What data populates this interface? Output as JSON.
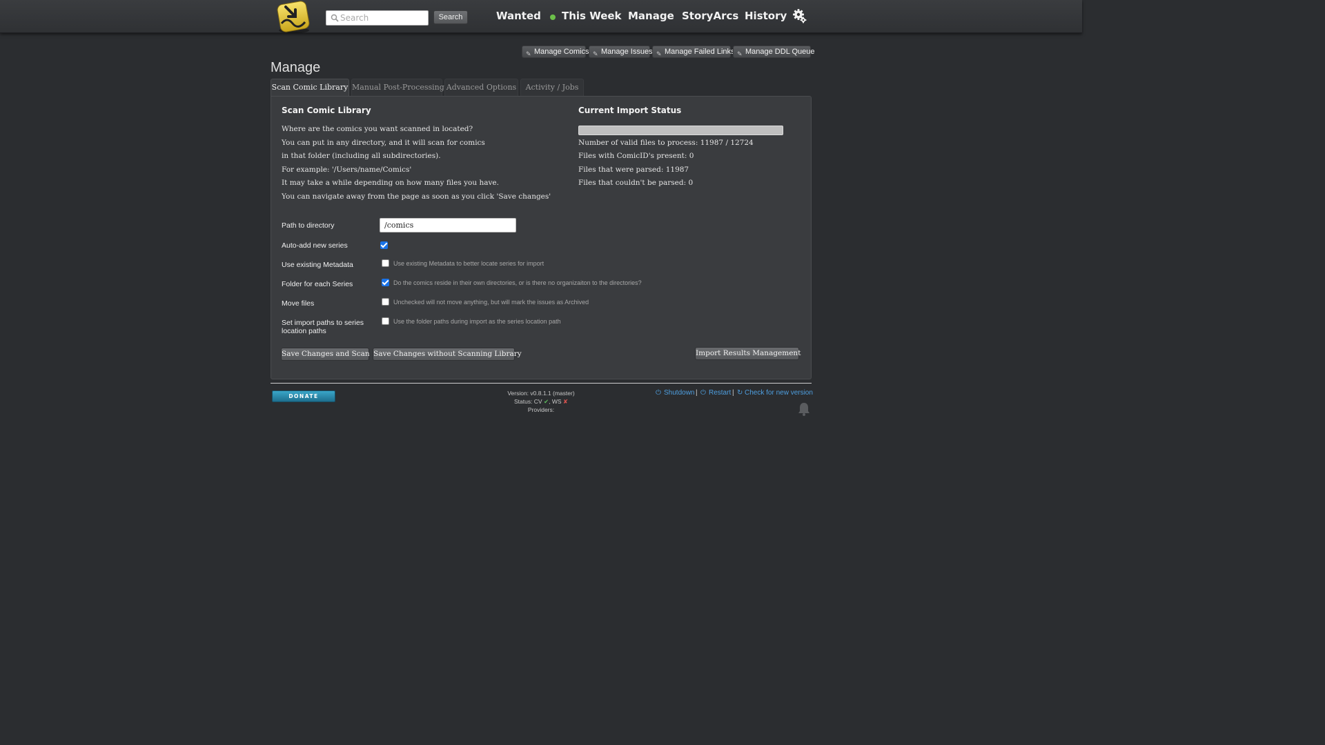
{
  "header": {
    "search_placeholder": "Search",
    "search_button": "Search",
    "nav": [
      "Wanted",
      "This Week",
      "Manage",
      "StoryArcs",
      "History"
    ]
  },
  "manage_buttons": [
    "Manage Comics",
    "Manage Issues",
    "Manage Failed Links",
    "Manage DDL Queue"
  ],
  "page_title": "Manage",
  "tabs": [
    "Scan Comic Library",
    "Manual Post-Processing",
    "Advanced Options",
    "Activity / Jobs"
  ],
  "scan": {
    "heading": "Scan Comic Library",
    "lines": [
      "Where are the comics you want scanned in located?",
      "You can put in any directory, and it will scan for comics",
      "in that folder (including all subdirectories).",
      "For example: '/Users/name/Comics'",
      "It may take a while depending on how many files you have.",
      "You can navigate away from the page as soon as you click 'Save changes'"
    ]
  },
  "status": {
    "heading": "Current Import Status",
    "progress_fraction": 1.0,
    "lines": [
      "Number of valid files to process: 11987 / 12724",
      "Files with ComicID's present: 0",
      "Files that were parsed: 11987",
      "Files that couldn't be parsed: 0"
    ]
  },
  "form": {
    "path_label": "Path to directory",
    "path_value": "/comics",
    "options": [
      {
        "label": "Auto-add new series",
        "checked": true,
        "hint": ""
      },
      {
        "label": "Use existing Metadata",
        "checked": false,
        "hint": "Use existing Metadata to better locate series for import"
      },
      {
        "label": "Folder for each Series",
        "checked": true,
        "hint": "Do the comics reside in their own directories, or is there no organizaiton to the directories?"
      },
      {
        "label": "Move files",
        "checked": false,
        "hint": "Unchecked will not move anything, but will mark the issues as Archived"
      },
      {
        "label_line1": "Set import paths to series",
        "label_line2": "location paths",
        "checked": false,
        "hint": "Use the folder paths during import as the series location path"
      }
    ]
  },
  "actions": {
    "save_scan": "Save Changes and Scan",
    "save_noscan": "Save Changes without Scanning Library",
    "import_results": "Import Results Management"
  },
  "footer": {
    "donate": "DONATE",
    "version": "Version: v0.8.1.1 (master)",
    "status_prefix": "Status: CV",
    "status_mid": ", WS",
    "providers": "Providers:",
    "shutdown": "Shutdown",
    "restart": "Restart",
    "check_version": "Check for new version"
  },
  "colors": {
    "background": "#2b2d30",
    "panel": "#3a3c3f",
    "link": "#4e9fe0",
    "checkbox": "#1a73e8",
    "status_dot": "#6cc04a"
  }
}
